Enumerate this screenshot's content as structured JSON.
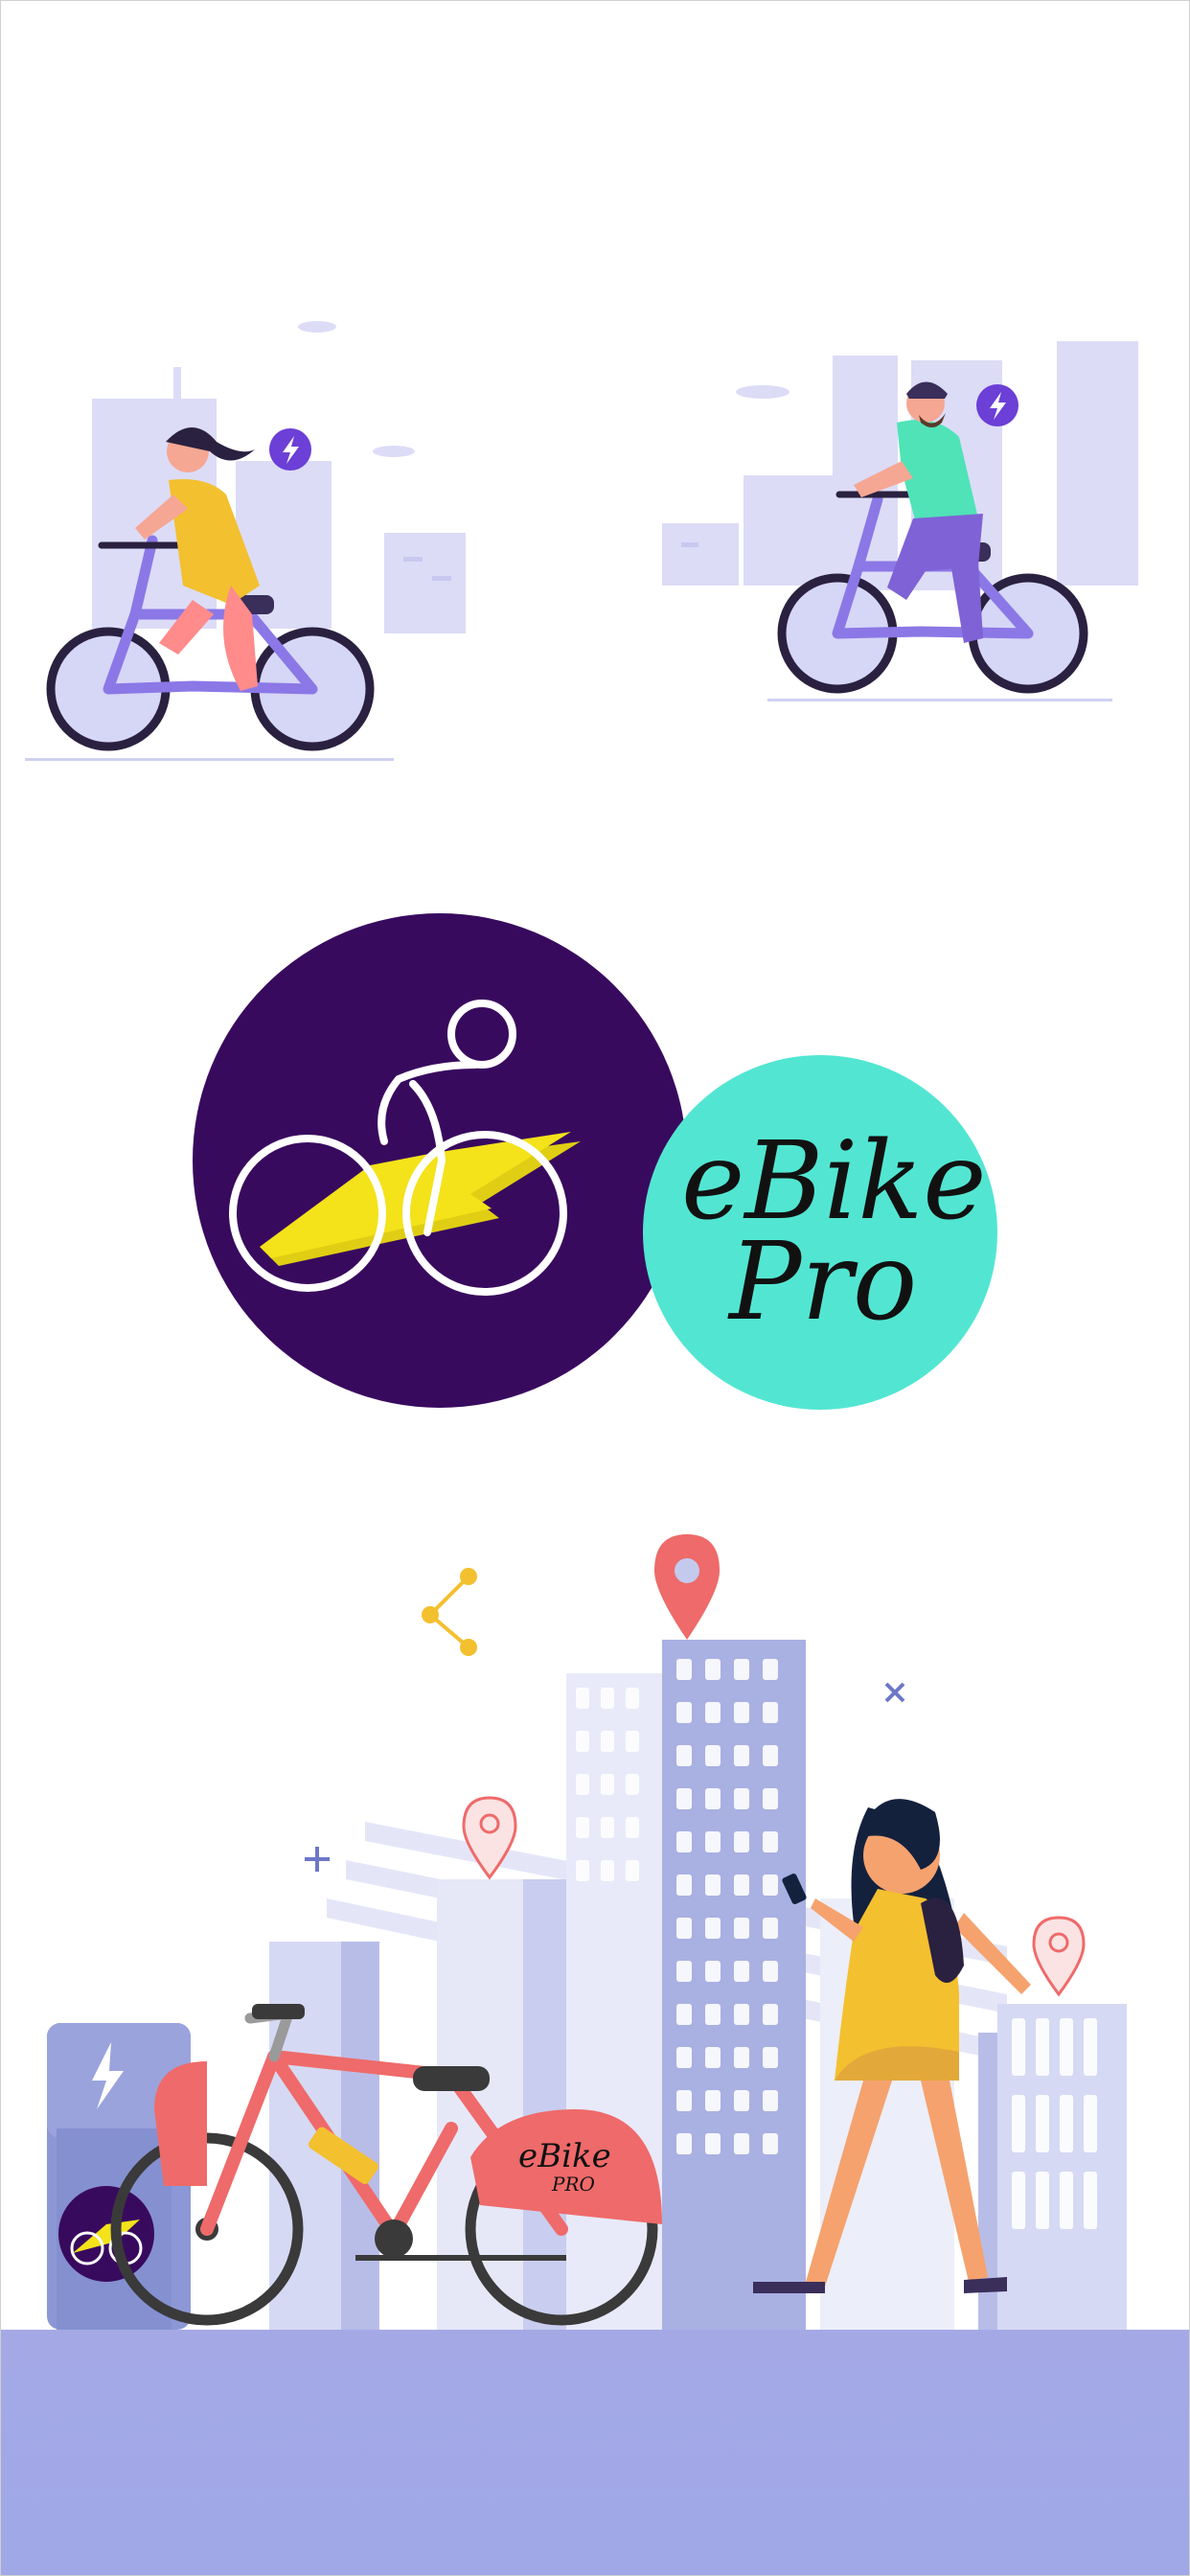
{
  "splash": {
    "logo": {
      "wordmark_line1": "eBike",
      "wordmark_line2": "Pro",
      "colors": {
        "purple": "#380a5e",
        "teal": "#52e6d2",
        "bolt": "#f4e21a"
      }
    },
    "bike_badge": {
      "line1": "eBike",
      "line2": "PRO"
    },
    "icons": {
      "top_left": "woman-riding-bike-illustration",
      "top_right": "man-riding-bike-illustration",
      "bottom": "city-bike-station-illustration",
      "charging": "lightning-bolt-icon",
      "location": "map-pin-icon"
    },
    "colors": {
      "background": "#ffffff",
      "ground": "#a4a9e6",
      "buildings": "#dcdcf7",
      "accent_red": "#ef6a6a",
      "dress_yellow": "#f3c02f"
    }
  }
}
